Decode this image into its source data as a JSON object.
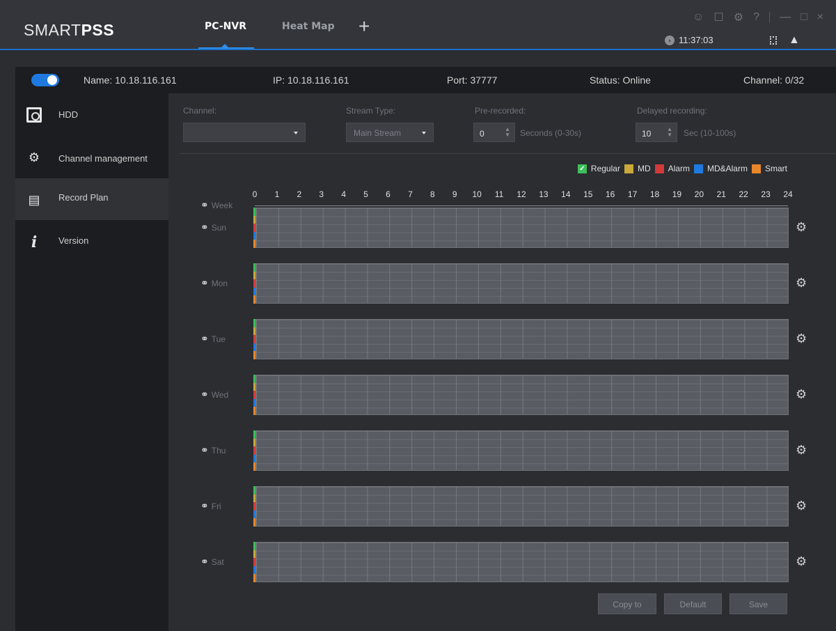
{
  "app": {
    "brand_light": "SMART",
    "brand_bold": "PSS",
    "tabs": [
      "PC-NVR",
      "Heat Map"
    ],
    "add_tab": "+",
    "time": "11:37:03"
  },
  "device": {
    "name": "Name: 10.18.116.161",
    "ip": "IP: 10.18.116.161",
    "port": "Port: 37777",
    "status": "Status: Online",
    "channel": "Channel: 0/32"
  },
  "sidebar": {
    "items": [
      {
        "label": "HDD",
        "icon": "hdd-icon"
      },
      {
        "label": "Channel management",
        "icon": "camera-gear-icon"
      },
      {
        "label": "Record Plan",
        "icon": "clipboard-icon"
      },
      {
        "label": "Version",
        "icon": "info-icon"
      }
    ],
    "active": "Record Plan"
  },
  "form": {
    "channel_label": "Channel:",
    "channel_value": "",
    "stream_label": "Stream Type:",
    "stream_value": "Main Stream",
    "prerecord_label": "Pre-recorded:",
    "prerecord_value": "0",
    "prerecord_unit": "Seconds (0-30s)",
    "delay_label": "Delayed recording:",
    "delay_value": "10",
    "delay_unit": "Sec (10-100s)"
  },
  "legend": [
    {
      "label": "Regular",
      "color": "#3dbf5a",
      "checked": true
    },
    {
      "label": "MD",
      "color": "#c9a93a"
    },
    {
      "label": "Alarm",
      "color": "#d23a3a"
    },
    {
      "label": "MD&Alarm",
      "color": "#1f7ae0"
    },
    {
      "label": "Smart",
      "color": "#e8862a"
    }
  ],
  "schedule": {
    "week_label": "Week",
    "hours": [
      "0",
      "1",
      "2",
      "3",
      "4",
      "5",
      "6",
      "7",
      "8",
      "9",
      "10",
      "11",
      "12",
      "13",
      "14",
      "15",
      "16",
      "17",
      "18",
      "19",
      "20",
      "21",
      "22",
      "23",
      "24"
    ],
    "days": [
      "Sun",
      "Mon",
      "Tue",
      "Wed",
      "Thu",
      "Fri",
      "Sat"
    ]
  },
  "buttons": {
    "copy": "Copy to",
    "default": "Default",
    "save": "Save"
  }
}
